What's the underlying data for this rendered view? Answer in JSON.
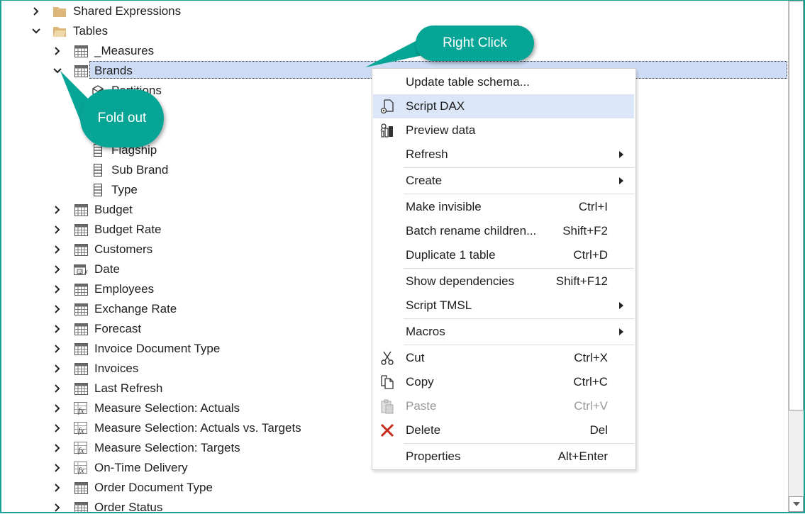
{
  "tree": {
    "rows": [
      {
        "label": "Shared Expressions",
        "icon": "folder-icon",
        "expander": "collapsed",
        "level": 0
      },
      {
        "label": "Tables",
        "icon": "folder-open-icon",
        "expander": "expanded",
        "level": 0
      },
      {
        "label": "_Measures",
        "icon": "table-icon",
        "expander": "collapsed",
        "level": 1
      },
      {
        "label": "Brands",
        "icon": "table-icon",
        "expander": "expanded",
        "level": 1,
        "selected": true
      },
      {
        "label": "Partitions",
        "icon": "partitions-icon",
        "expander": "none",
        "level": 2
      },
      {
        "label": "",
        "icon": "column-icon",
        "expander": "none",
        "level": 2
      },
      {
        "label": "",
        "icon": "column-icon",
        "expander": "none",
        "level": 2
      },
      {
        "label": "Flagship",
        "icon": "column-icon",
        "expander": "none",
        "level": 2
      },
      {
        "label": "Sub Brand",
        "icon": "column-icon",
        "expander": "none",
        "level": 2
      },
      {
        "label": "Type",
        "icon": "column-icon",
        "expander": "none",
        "level": 2
      },
      {
        "label": "Budget",
        "icon": "table-icon",
        "expander": "collapsed",
        "level": 1
      },
      {
        "label": "Budget Rate",
        "icon": "table-icon",
        "expander": "collapsed",
        "level": 1
      },
      {
        "label": "Customers",
        "icon": "table-icon",
        "expander": "collapsed",
        "level": 1
      },
      {
        "label": "Date",
        "icon": "calendar-table-icon",
        "expander": "collapsed",
        "level": 1
      },
      {
        "label": "Employees",
        "icon": "table-icon",
        "expander": "collapsed",
        "level": 1
      },
      {
        "label": "Exchange Rate",
        "icon": "table-icon",
        "expander": "collapsed",
        "level": 1
      },
      {
        "label": "Forecast",
        "icon": "table-icon",
        "expander": "collapsed",
        "level": 1
      },
      {
        "label": "Invoice Document Type",
        "icon": "table-icon",
        "expander": "collapsed",
        "level": 1
      },
      {
        "label": "Invoices",
        "icon": "table-icon",
        "expander": "collapsed",
        "level": 1
      },
      {
        "label": "Last Refresh",
        "icon": "table-icon",
        "expander": "collapsed",
        "level": 1
      },
      {
        "label": "Measure Selection: Actuals",
        "icon": "calc-table-icon",
        "expander": "collapsed",
        "level": 1
      },
      {
        "label": "Measure Selection: Actuals vs. Targets",
        "icon": "calc-table-icon",
        "expander": "collapsed",
        "level": 1
      },
      {
        "label": "Measure Selection: Targets",
        "icon": "calc-table-icon",
        "expander": "collapsed",
        "level": 1
      },
      {
        "label": "On-Time Delivery",
        "icon": "calc-table-icon",
        "expander": "collapsed",
        "level": 1
      },
      {
        "label": "Order Document Type",
        "icon": "table-icon",
        "expander": "collapsed",
        "level": 1
      },
      {
        "label": "Order Status",
        "icon": "table-icon",
        "expander": "collapsed",
        "level": 1
      }
    ]
  },
  "context_menu": {
    "items": [
      {
        "label": "Update table schema...",
        "shortcut": "",
        "icon": "",
        "submenu": false
      },
      {
        "label": "Script DAX",
        "shortcut": "",
        "icon": "script-dax-icon",
        "submenu": false,
        "hover": true
      },
      {
        "label": "Preview data",
        "shortcut": "",
        "icon": "preview-data-icon",
        "submenu": false
      },
      {
        "label": "Refresh",
        "shortcut": "",
        "icon": "",
        "submenu": true
      },
      {
        "label": "Create",
        "shortcut": "",
        "icon": "",
        "submenu": true
      },
      {
        "label": "Make invisible",
        "shortcut": "Ctrl+I",
        "icon": "",
        "submenu": false
      },
      {
        "label": "Batch rename children...",
        "shortcut": "Shift+F2",
        "icon": "",
        "submenu": false
      },
      {
        "label": "Duplicate 1 table",
        "shortcut": "Ctrl+D",
        "icon": "",
        "submenu": false
      },
      {
        "label": "Show dependencies",
        "shortcut": "Shift+F12",
        "icon": "",
        "submenu": false
      },
      {
        "label": "Script TMSL",
        "shortcut": "",
        "icon": "",
        "submenu": true
      },
      {
        "label": "Macros",
        "shortcut": "",
        "icon": "",
        "submenu": true
      },
      {
        "label": "Cut",
        "shortcut": "Ctrl+X",
        "icon": "cut-icon",
        "submenu": false
      },
      {
        "label": "Copy",
        "shortcut": "Ctrl+C",
        "icon": "copy-icon",
        "submenu": false
      },
      {
        "label": "Paste",
        "shortcut": "Ctrl+V",
        "icon": "paste-icon",
        "submenu": false,
        "disabled": true
      },
      {
        "label": "Delete",
        "shortcut": "Del",
        "icon": "delete-icon",
        "submenu": false
      },
      {
        "label": "Properties",
        "shortcut": "Alt+Enter",
        "icon": "",
        "submenu": false
      }
    ]
  },
  "callouts": {
    "right_click": "Right Click",
    "fold_out": "Fold out"
  },
  "colors": {
    "accent": "#07a595",
    "selection": "#cddcf4",
    "menu_hover": "#dbe7f8",
    "delete_red": "#c42b1c"
  }
}
